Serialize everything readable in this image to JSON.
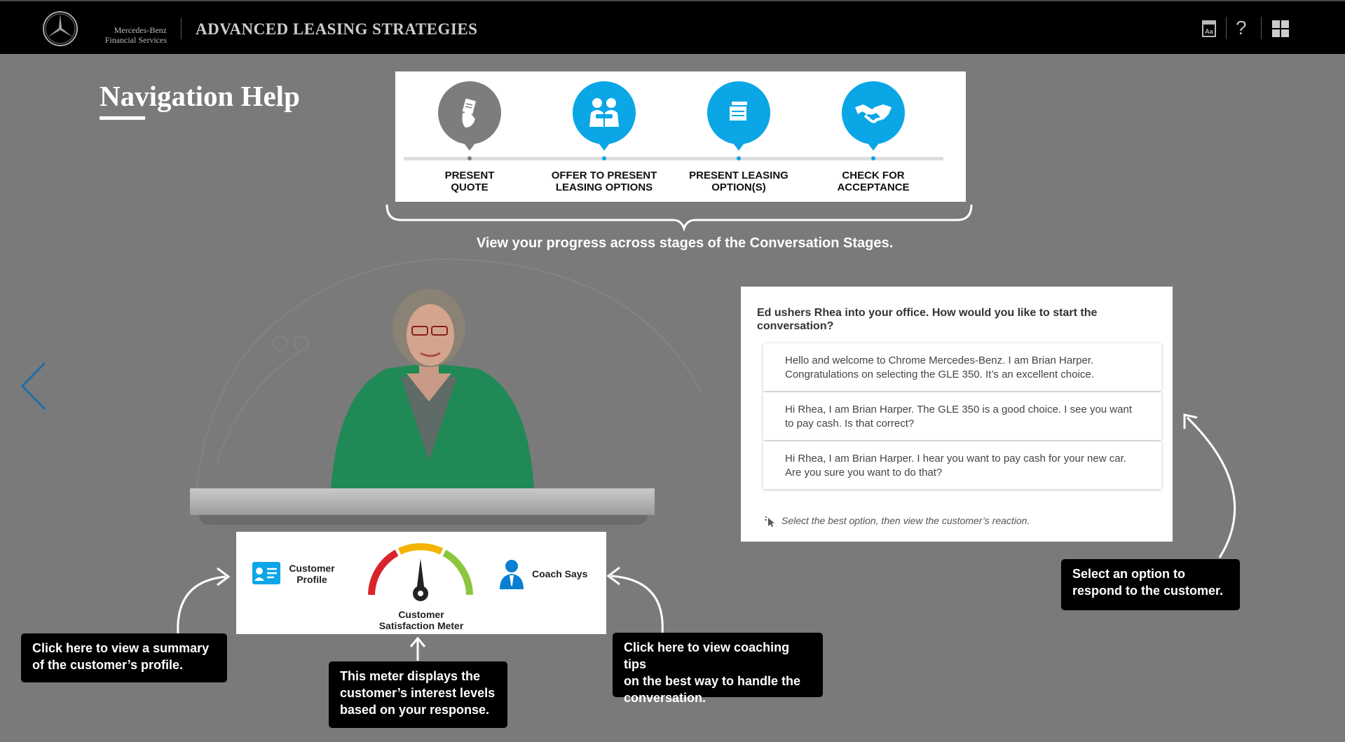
{
  "header": {
    "brand_line1": "Mercedes-Benz",
    "brand_line2": "Financial Services",
    "title": "ADVANCED LEASING STRATEGIES",
    "icons": [
      "glossary-icon",
      "help-icon",
      "menu-grid-icon"
    ],
    "help_glyph": "?",
    "glossary_glyph": "Aa"
  },
  "page": {
    "title": "Navigation Help"
  },
  "stages": {
    "items": [
      {
        "label_line1": "PRESENT",
        "label_line2": "QUOTE",
        "state": "current",
        "icon": "hand-document-icon"
      },
      {
        "label_line1": "OFFER TO PRESENT",
        "label_line2": "LEASING OPTIONS",
        "state": "upcoming",
        "icon": "people-icon"
      },
      {
        "label_line1": "PRESENT LEASING",
        "label_line2": "OPTION(S)",
        "state": "upcoming",
        "icon": "documents-icon"
      },
      {
        "label_line1": "CHECK FOR",
        "label_line2": "ACCEPTANCE",
        "state": "upcoming",
        "icon": "handshake-icon"
      }
    ],
    "caption": "View your progress across stages of the Conversation Stages."
  },
  "dialog": {
    "question": "Ed ushers Rhea into your office. How would you like to start the conversation?",
    "options": [
      "Hello and welcome to Chrome Mercedes-Benz. I am Brian Harper. Congratulations on selecting the GLE 350. It’s an excellent choice.",
      "Hi Rhea, I am Brian Harper. The GLE 350 is a good choice. I see you want to pay cash. Is that correct?",
      "Hi Rhea, I am Brian Harper. I hear you want to pay cash for your new car. Are you sure you want to do that?"
    ],
    "hint": "Select the best option, then view the customer’s reaction."
  },
  "hud": {
    "profile_line1": "Customer",
    "profile_line2": "Profile",
    "meter_line1": "Customer",
    "meter_line2": "Satisfaction Meter",
    "coach_label": "Coach Says"
  },
  "tips": {
    "profile": {
      "line1": "Click here to view a summary",
      "line2": "of the customer’s profile."
    },
    "meter": {
      "line1": "This meter displays the",
      "line2": "customer’s interest levels",
      "line3": "based on your response."
    },
    "coach": {
      "line1": "Click here to view coaching tips",
      "line2": "on the best way to handle the",
      "line3": "conversation."
    },
    "options": {
      "line1": "Select an option to",
      "line2": "respond to the customer."
    }
  },
  "colors": {
    "background": "#7a7a7a",
    "header": "#000000",
    "stage_active": "#7d7d7d",
    "stage_blue": "#0aa6e6",
    "meter_red": "#d8232a",
    "meter_yellow": "#f2b400",
    "meter_green": "#8cc63f"
  }
}
